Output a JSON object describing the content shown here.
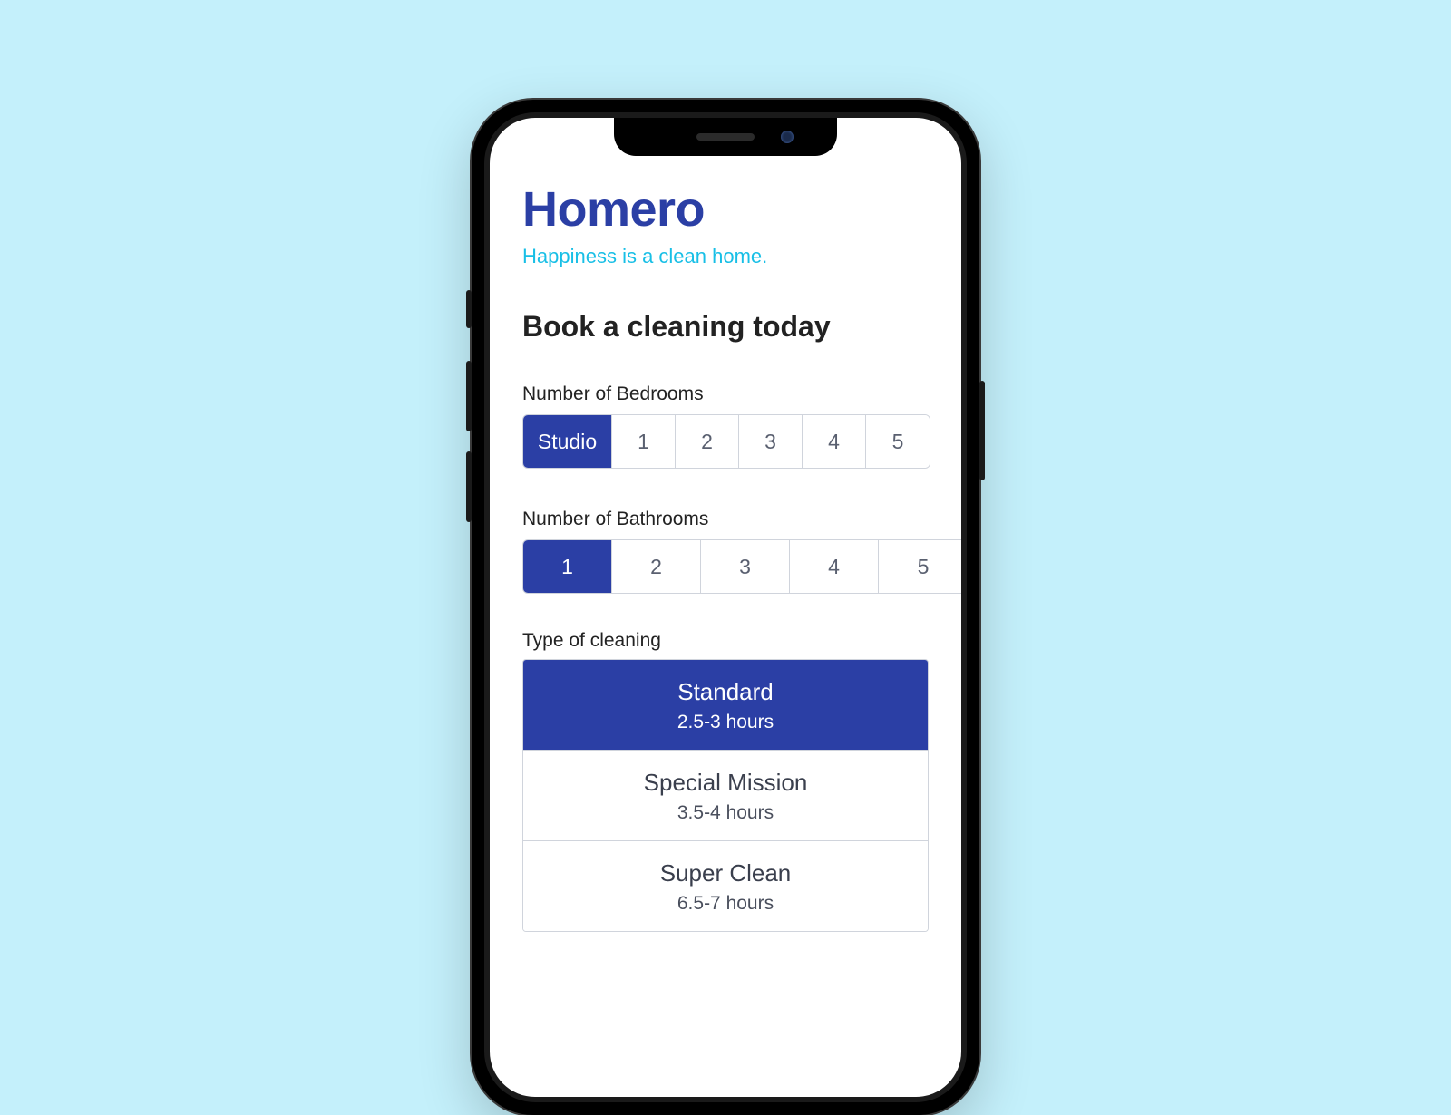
{
  "brand": {
    "title": "Homero",
    "tagline": "Happiness is a clean home."
  },
  "booking": {
    "heading": "Book a cleaning today",
    "bedrooms": {
      "label": "Number of Bedrooms",
      "options": [
        "Studio",
        "1",
        "2",
        "3",
        "4",
        "5"
      ],
      "selected": "Studio"
    },
    "bathrooms": {
      "label": "Number of Bathrooms",
      "options": [
        "1",
        "2",
        "3",
        "4",
        "5"
      ],
      "selected": "1"
    },
    "cleaning_type": {
      "label": "Type of cleaning",
      "options": [
        {
          "name": "Standard",
          "duration": "2.5-3 hours"
        },
        {
          "name": "Special Mission",
          "duration": "3.5-4 hours"
        },
        {
          "name": "Super Clean",
          "duration": "6.5-7 hours"
        }
      ],
      "selected": "Standard"
    }
  },
  "colors": {
    "primary": "#2b3fa5",
    "accent": "#18bfe6",
    "background": "#c4f0fb"
  }
}
